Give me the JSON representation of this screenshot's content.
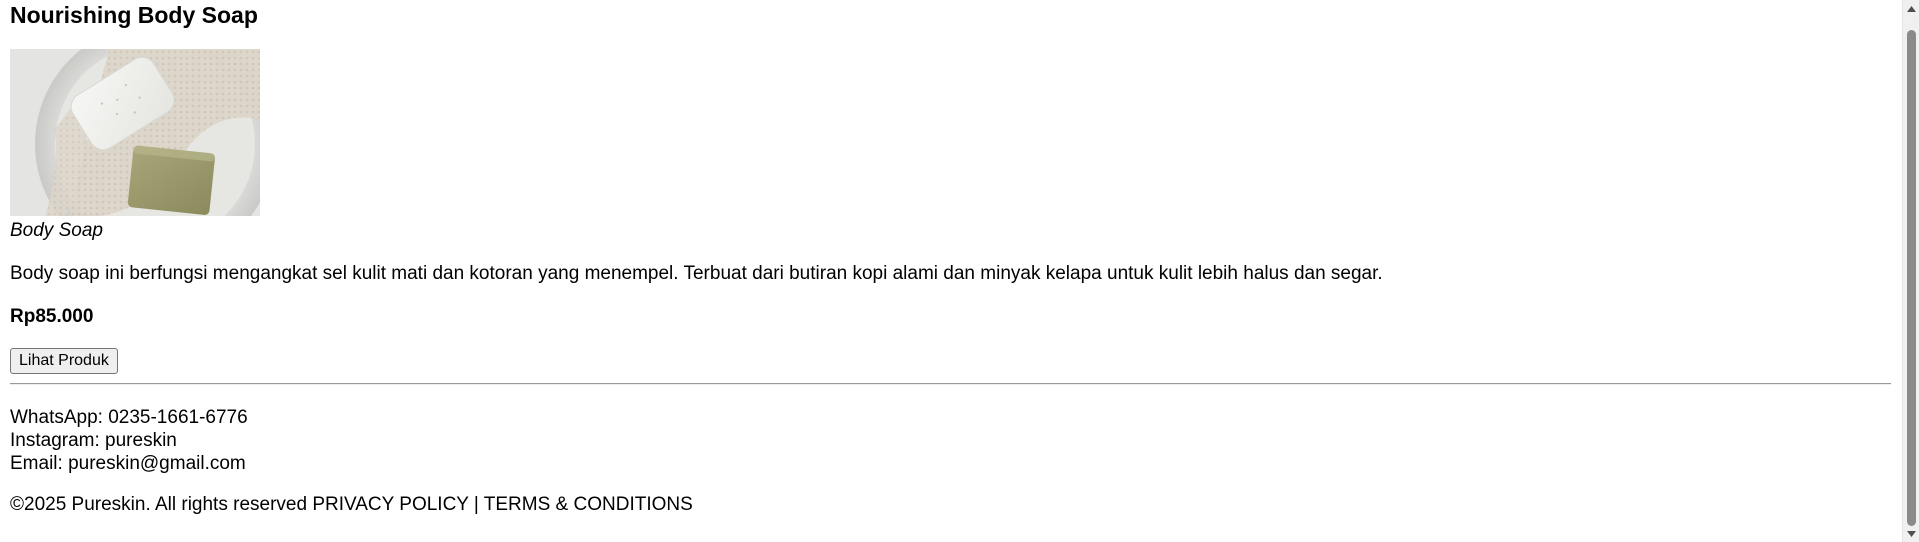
{
  "product": {
    "title": "Nourishing Body Soap",
    "image_alt": "Body Soap",
    "caption": "Body Soap",
    "description": "Body soap ini berfungsi mengangkat sel kulit mati dan kotoran yang menempel. Terbuat dari butiran kopi alami dan minyak kelapa untuk kulit lebih halus dan segar.",
    "price": "Rp85.000",
    "button_label": "Lihat Produk"
  },
  "contact": {
    "whatsapp": "WhatsApp: 0235-1661-6776",
    "instagram": "Instagram: pureskin",
    "email": "Email: pureskin@gmail.com"
  },
  "footer": {
    "copyright": "©2025 Pureskin. All rights reserved",
    "privacy_label": "PRIVACY POLICY",
    "separator": "|",
    "terms_label": "TERMS & CONDITIONS"
  },
  "icons": {
    "scroll_up": "triangle-up-icon",
    "scroll_down": "triangle-down-icon"
  },
  "colors": {
    "text": "#000000",
    "background": "#ffffff",
    "button_bg": "#efefef",
    "scroll_thumb": "#8a8a8a"
  }
}
